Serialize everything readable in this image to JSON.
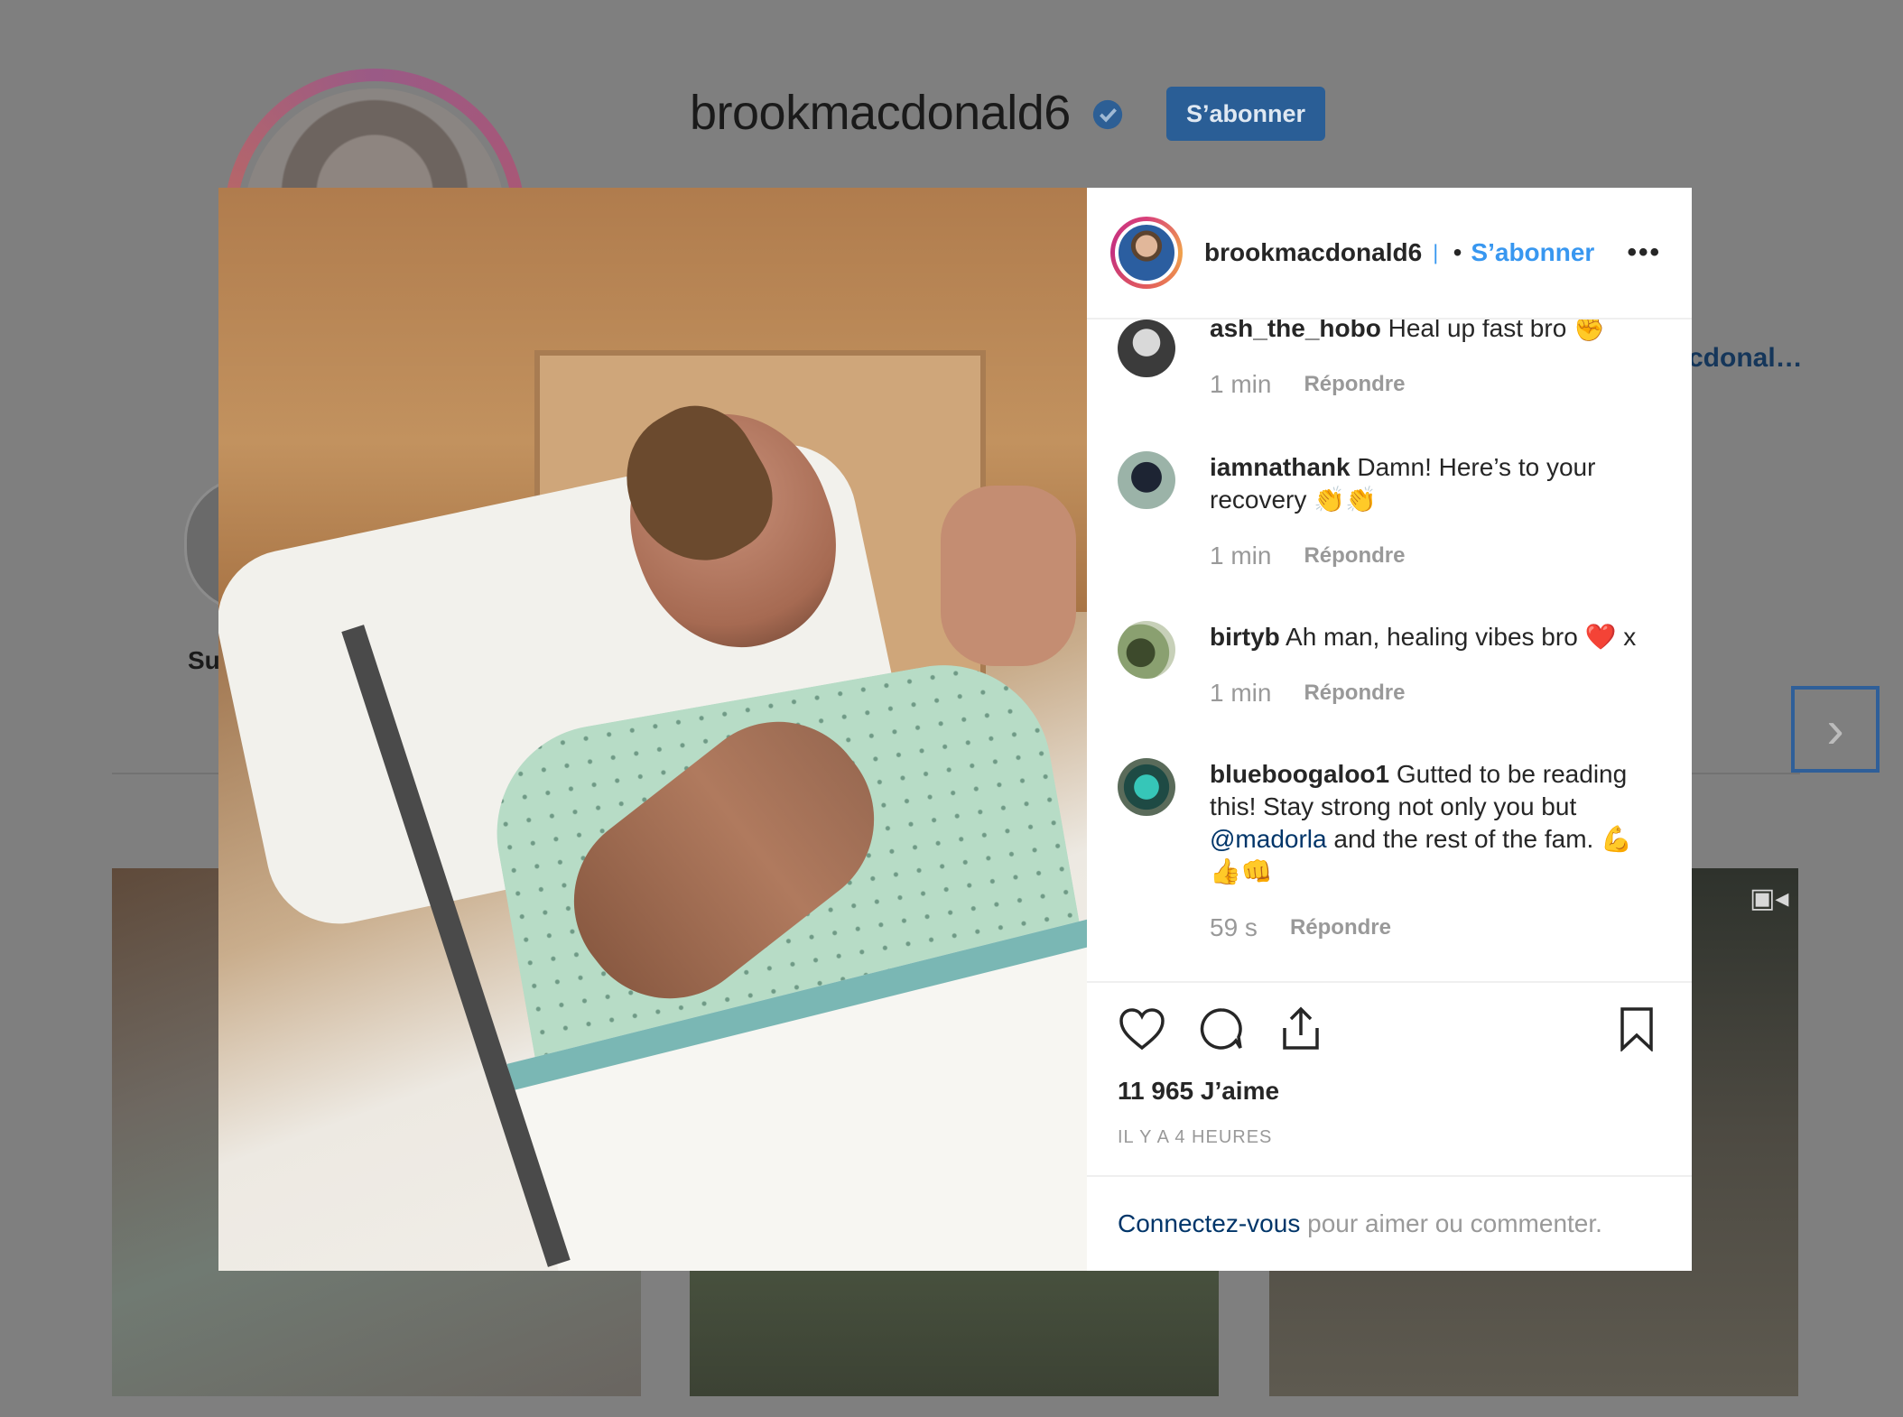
{
  "background": {
    "username": "brookmacdonald6",
    "follow_label": "S’abonner",
    "bio_link_fragment": "cdonal…",
    "highlight_label_fragment": "Su",
    "next_icon": "chevron-right-icon"
  },
  "modal": {
    "header": {
      "username": "brookmacdonald6",
      "verified_icon": "verified-badge-icon",
      "separator": "•",
      "follow_label": "S’abonner",
      "more_label": "•••"
    },
    "comments": [
      {
        "user": "ash_the_hobo",
        "text": " Heal up fast bro ✊",
        "time": "1 min",
        "reply": "Répondre"
      },
      {
        "user": "iamnathank",
        "text": " Damn! Here’s to your recovery 👏👏",
        "time": "1 min",
        "reply": "Répondre"
      },
      {
        "user": "birtyb",
        "text": " Ah man, healing vibes bro ❤️ x",
        "time": "1 min",
        "reply": "Répondre"
      },
      {
        "user": "blueboogaloo1",
        "text_before": " Gutted to be reading this! Stay strong not only you but ",
        "mention": "@madorla",
        "text_after": " and the rest of the fam. 💪👍👊",
        "time": "59 s",
        "reply": "Répondre"
      }
    ],
    "actions": {
      "like_icon": "heart-icon",
      "comment_icon": "comment-icon",
      "share_icon": "share-icon",
      "save_icon": "bookmark-icon"
    },
    "likes": "11 965 J’aime",
    "time_ago": "IL Y A 4 HEURES",
    "login_link": "Connectez-vous",
    "login_text": " pour aimer ou commenter."
  },
  "colors": {
    "accent_blue": "#3897f0",
    "mention_blue": "#003569",
    "overlay": "#7f7f7f"
  }
}
